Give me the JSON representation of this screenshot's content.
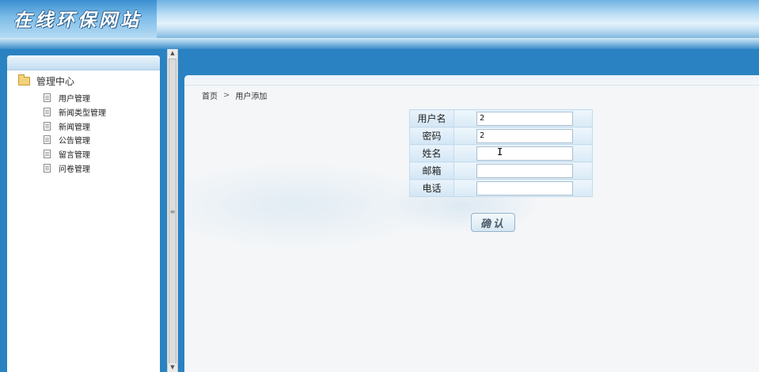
{
  "header": {
    "site_title": "在线环保网站"
  },
  "sidebar": {
    "root_label": "管理中心",
    "items": [
      {
        "label": "用户管理"
      },
      {
        "label": "新闻类型管理"
      },
      {
        "label": "新闻管理"
      },
      {
        "label": "公告管理"
      },
      {
        "label": "留言管理"
      },
      {
        "label": "问卷管理"
      }
    ]
  },
  "breadcrumb": {
    "home": "首页",
    "separator": ">",
    "current": "用户添加"
  },
  "form": {
    "fields": [
      {
        "label": "用户名",
        "value": "2"
      },
      {
        "label": "密码",
        "value": "2"
      },
      {
        "label": "姓名",
        "value": ""
      },
      {
        "label": "邮箱",
        "value": ""
      },
      {
        "label": "电话",
        "value": ""
      }
    ],
    "submit_label": "确认"
  },
  "icons": {
    "folder": "folder-open-icon",
    "item": "document-icon",
    "scroll_up": "arrow-up-icon",
    "scroll_down": "arrow-down-icon"
  }
}
